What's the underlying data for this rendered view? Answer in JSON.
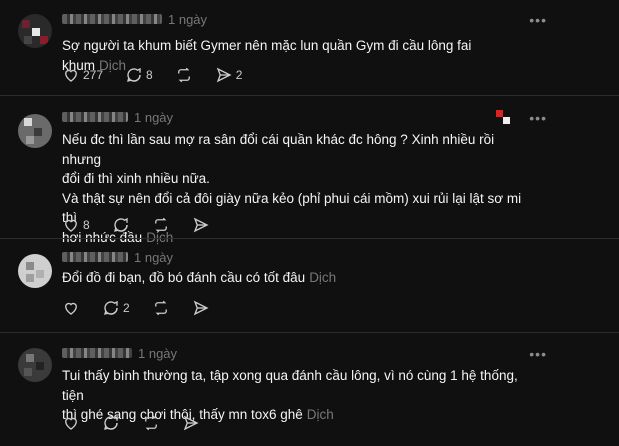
{
  "comments": [
    {
      "time": "1 ngày",
      "text": "Sợ người ta khum biết Gymer nên mặc lun quần Gym đi cầu lông fai khum",
      "translate": "Dịch",
      "likes": "277",
      "replies": "8",
      "reposts": "",
      "shares": "2"
    },
    {
      "time": "1 ngày",
      "text_lines": [
        "Nếu đc thì lần sau mợ ra sân đổi cái quần khác đc hông ? Xinh nhiều rồi nhưng",
        "đổi đi thì xinh nhiều nữa.",
        "Và thật sự nên đổi cả đôi giày nữa kẻo (phỉ phui cái mồm) xui rủi lại lật sơ mi thì",
        "hơi nhức đầu"
      ],
      "translate": "Dịch",
      "likes": "8",
      "replies": "",
      "reposts": "",
      "shares": ""
    },
    {
      "time": "1 ngày",
      "text": "Đổi đồ đi bạn, đồ bó đánh cầu có tốt đâu",
      "translate": "Dịch",
      "likes": "",
      "replies": "2",
      "reposts": "",
      "shares": ""
    },
    {
      "time": "1 ngày",
      "text_lines": [
        "Tui thấy bình thường ta, tập xong qua đánh cầu lông, vì nó cùng 1 hệ thống, tiện",
        "thì ghé sang chơi thôi, thấy mn tox6 ghê"
      ],
      "translate": "Dịch",
      "likes": "",
      "replies": "",
      "reposts": "",
      "shares": ""
    }
  ],
  "more_label": "•••"
}
